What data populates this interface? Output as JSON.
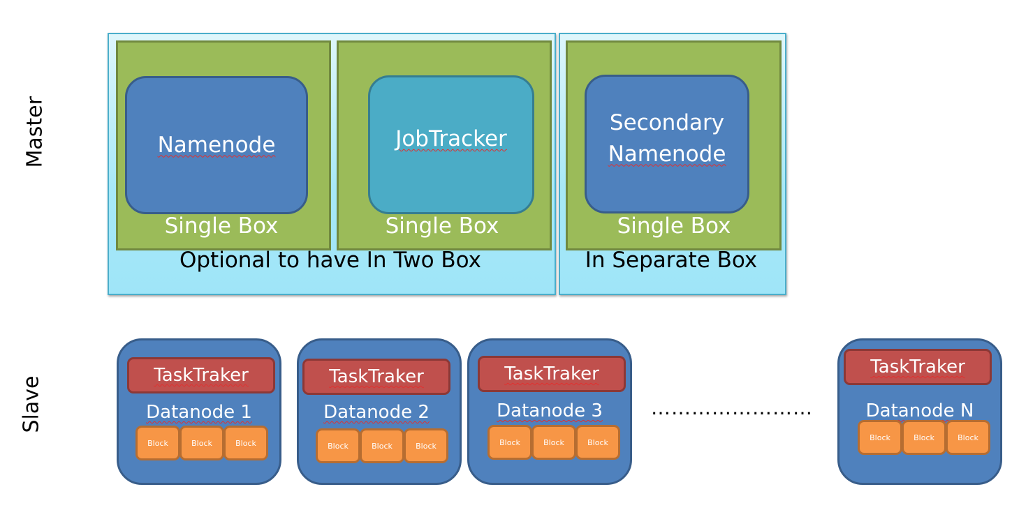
{
  "labels": {
    "master": "Master",
    "slave": "Slave"
  },
  "master": {
    "groups": [
      {
        "caption": "Optional to have In Two Box"
      },
      {
        "caption": "In Separate Box"
      }
    ],
    "boxes": [
      {
        "node": "Namenode",
        "caption": "Single Box"
      },
      {
        "node": "JobTracker",
        "caption": "Single Box"
      },
      {
        "node_line1": "Secondary",
        "node_line2": "Namenode",
        "caption": "Single Box"
      }
    ]
  },
  "slaves": [
    {
      "tasktracker": "TaskTraker",
      "datanode": "Datanode 1",
      "blocks": [
        "Block",
        "Block",
        "Block"
      ]
    },
    {
      "tasktracker": "TaskTraker",
      "datanode": "Datanode 2",
      "blocks": [
        "Block",
        "Block",
        "Block"
      ]
    },
    {
      "tasktracker": "TaskTraker",
      "datanode": "Datanode 3",
      "blocks": [
        "Block",
        "Block",
        "Block"
      ]
    },
    {
      "tasktracker": "TaskTraker",
      "datanode": "Datanode N",
      "blocks": [
        "Block",
        "Block",
        "Block"
      ]
    }
  ],
  "ellipsis": "……………………",
  "colors": {
    "group_fill": "#a7e8f7",
    "box_fill": "#9bbb59",
    "node_blue": "#4f81bd",
    "node_teal": "#4bacc6",
    "tasktracker": "#c0504d",
    "block": "#f79646"
  }
}
